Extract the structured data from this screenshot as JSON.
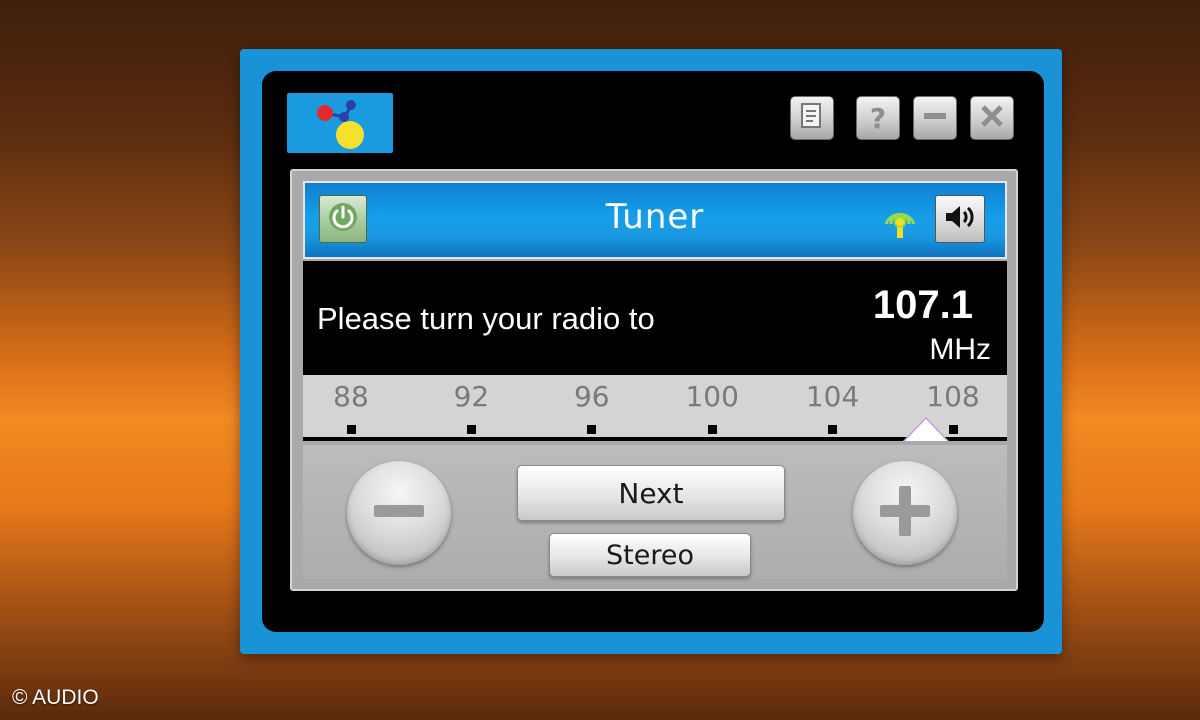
{
  "copyright": "© AUDIO",
  "titlebar": {
    "logo_icon": "molecule-logo-icon",
    "buttons": [
      {
        "icon": "notes-icon"
      },
      {
        "icon": "help-icon",
        "glyph": "?"
      },
      {
        "icon": "minimize-icon"
      },
      {
        "icon": "close-icon"
      }
    ]
  },
  "tuner": {
    "title": "Tuner",
    "power_icon": "power-icon",
    "signal_icon": "antenna-signal-icon",
    "speaker_icon": "speaker-icon",
    "prompt": "Please turn your radio to",
    "frequency": "107.1",
    "unit": "MHz",
    "scale": {
      "min": 88,
      "max": 108,
      "ticks": [
        "88",
        "92",
        "96",
        "100",
        "104",
        "108"
      ],
      "pointer_value": 107.1
    },
    "controls": {
      "minus_icon": "minus-icon",
      "plus_icon": "plus-icon",
      "next_label": "Next",
      "stereo_label": "Stereo"
    }
  },
  "colors": {
    "frame_blue": "#1a93d6",
    "header_blue": "#169ee8",
    "signal_green": "#9bd84a",
    "power_green": "#8cb57e"
  }
}
